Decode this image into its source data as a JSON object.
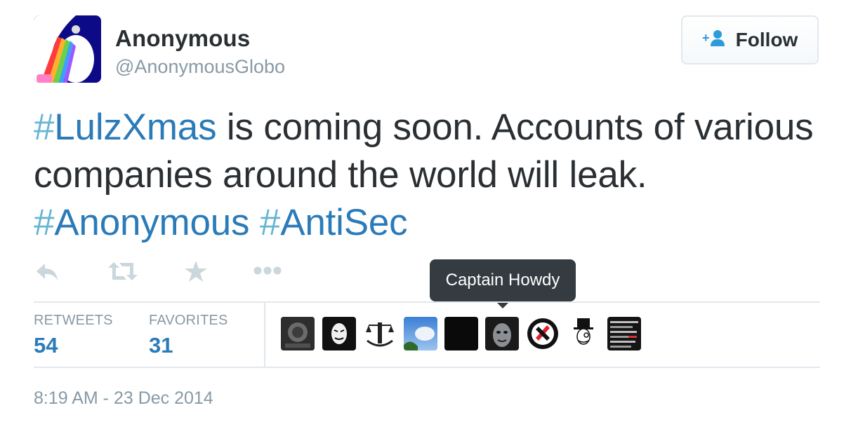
{
  "user": {
    "name": "Anonymous",
    "handle": "@AnonymousGlobo"
  },
  "follow": {
    "label": "Follow"
  },
  "tweet": {
    "segments": [
      {
        "type": "hashtag",
        "hash": "#",
        "word": "LulzXmas"
      },
      {
        "type": "text",
        "text": " is coming soon. Accounts of various companies around the world will leak. "
      },
      {
        "type": "hashtag",
        "hash": "#",
        "word": "Anonymous"
      },
      {
        "type": "text",
        "text": " "
      },
      {
        "type": "hashtag",
        "hash": "#",
        "word": "AntiSec"
      }
    ]
  },
  "actions": [
    {
      "icon": "reply-icon"
    },
    {
      "icon": "retweet-icon"
    },
    {
      "icon": "favorite-star-icon"
    },
    {
      "icon": "more-options-icon"
    }
  ],
  "tooltip": {
    "text": "Captain Howdy"
  },
  "stats": {
    "retweets": {
      "label": "RETWEETS",
      "value": "54"
    },
    "favorites": {
      "label": "FAVORITES",
      "value": "31"
    }
  },
  "timestamp": "8:19 AM - 23 Dec 2014",
  "colors": {
    "link": "#2b7bb9",
    "muted": "#8899a6",
    "text": "#292f33",
    "border": "#e1e8ed",
    "tooltip_bg": "#343c41"
  }
}
